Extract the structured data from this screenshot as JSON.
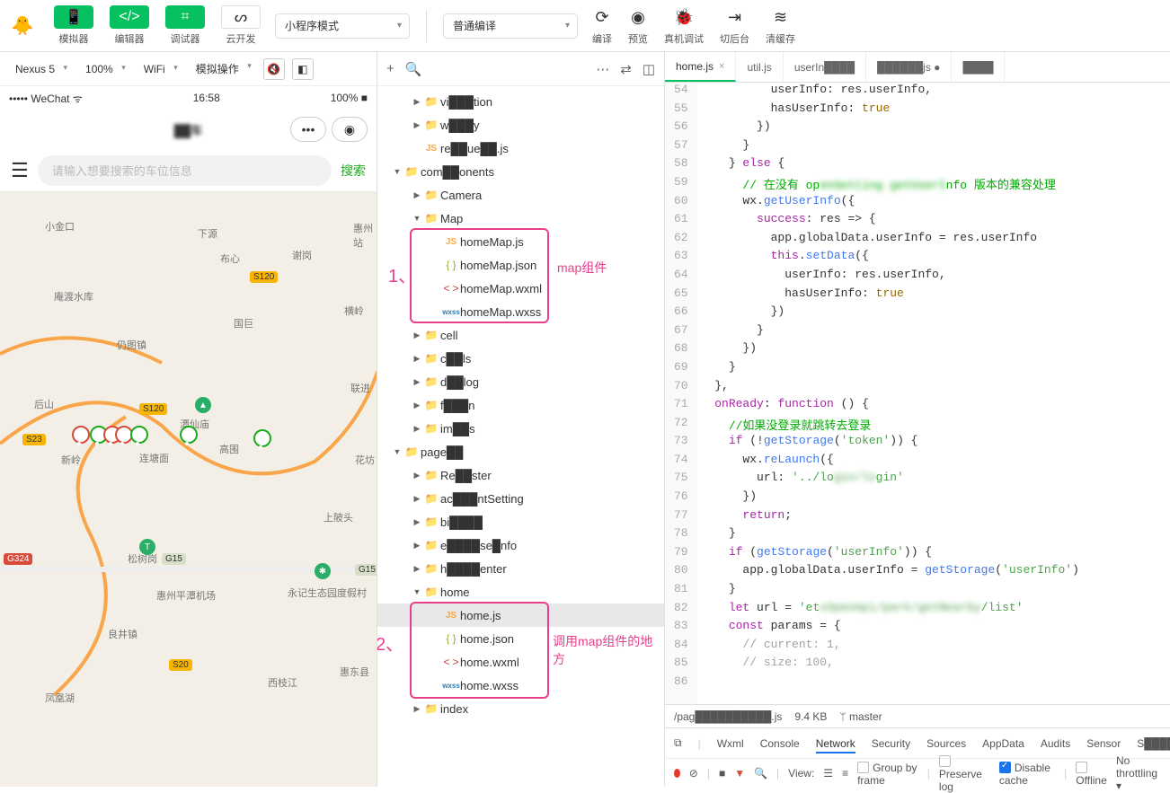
{
  "toolbar": {
    "simulator": "模拟器",
    "editor": "编辑器",
    "debugger": "调试器",
    "cloud": "云开发",
    "mode_select": "小程序模式",
    "compile_select": "普通编译",
    "compile": "编译",
    "preview": "预览",
    "remote_debug": "真机调试",
    "background": "切后台",
    "clear_cache": "清缓存"
  },
  "sim_bar": {
    "device": "Nexus 5",
    "zoom": "100%",
    "network": "WiFi",
    "operation": "模拟操作"
  },
  "phone": {
    "carrier": "••••• WeChat",
    "wifi_icon": "ᯤ",
    "time": "16:58",
    "battery_pct": "100%",
    "battery_icon": "▮▮▮",
    "title": "██车",
    "search_placeholder": "请输入想要搜索的车位信息",
    "search_btn": "搜索"
  },
  "map_labels": {
    "l1": "小金口",
    "l2": "下源",
    "l3": "谢岗",
    "l4": "惠州站",
    "l5": "仍图镇",
    "l6": "布心",
    "l7": "国巨",
    "l8": "横岭",
    "l9": "后山",
    "l10": "新岭",
    "l11": "潭仙庙",
    "l12": "连塘面",
    "l13": "高围",
    "l14": "花坊",
    "l15": "上陂头",
    "l16": "松树岗",
    "l17": "惠州平潭机场",
    "l18": "永记生态园度假村",
    "l19": "良井镇",
    "l20": "凤凰湖",
    "l21": "西枝江",
    "l22": "庵渡水库",
    "l23": "惠东县",
    "l24": "联进"
  },
  "badges": {
    "s120a": "S120",
    "s120b": "S120",
    "s23": "S23",
    "g324": "G324",
    "s20": "S20",
    "g15a": "G15",
    "g15b": "G15"
  },
  "tree": {
    "items": [
      {
        "d": 1,
        "t": "f",
        "ic": "fld",
        "n": "vi███tion"
      },
      {
        "d": 1,
        "t": "f",
        "ic": "fld",
        "n": "w███y"
      },
      {
        "d": 1,
        "t": "l",
        "ic": "js",
        "n": "re██ue██.js"
      },
      {
        "d": 0,
        "t": "o",
        "ic": "fld",
        "n": "com██onents"
      },
      {
        "d": 1,
        "t": "f",
        "ic": "fld",
        "n": "Camera"
      },
      {
        "d": 1,
        "t": "o",
        "ic": "fld",
        "n": "Map"
      },
      {
        "d": 2,
        "t": "l",
        "ic": "js",
        "n": "homeMap.js"
      },
      {
        "d": 2,
        "t": "l",
        "ic": "json",
        "n": "homeMap.json"
      },
      {
        "d": 2,
        "t": "l",
        "ic": "wxml",
        "n": "homeMap.wxml"
      },
      {
        "d": 2,
        "t": "l",
        "ic": "wxss",
        "n": "homeMap.wxss"
      },
      {
        "d": 1,
        "t": "f",
        "ic": "fld",
        "n": "cell"
      },
      {
        "d": 1,
        "t": "f",
        "ic": "fld",
        "n": "c██ls"
      },
      {
        "d": 1,
        "t": "f",
        "ic": "fld",
        "n": "d██log"
      },
      {
        "d": 1,
        "t": "f",
        "ic": "fld",
        "n": "f███n"
      },
      {
        "d": 1,
        "t": "f",
        "ic": "fld",
        "n": "im██s"
      },
      {
        "d": 0,
        "t": "o",
        "ic": "fld",
        "n": "page██"
      },
      {
        "d": 1,
        "t": "f",
        "ic": "fld",
        "n": "Re██ster"
      },
      {
        "d": 1,
        "t": "f",
        "ic": "fld",
        "n": "ac███ntSetting"
      },
      {
        "d": 1,
        "t": "f",
        "ic": "fld",
        "n": "bi████"
      },
      {
        "d": 1,
        "t": "f",
        "ic": "fld",
        "n": "e████se█nfo"
      },
      {
        "d": 1,
        "t": "f",
        "ic": "fld",
        "n": "h████enter"
      },
      {
        "d": 1,
        "t": "o",
        "ic": "fld",
        "n": "home"
      },
      {
        "d": 2,
        "t": "l",
        "ic": "js",
        "n": "home.js",
        "sel": true
      },
      {
        "d": 2,
        "t": "l",
        "ic": "json",
        "n": "home.json"
      },
      {
        "d": 2,
        "t": "l",
        "ic": "wxml",
        "n": "home.wxml"
      },
      {
        "d": 2,
        "t": "l",
        "ic": "wxss",
        "n": "home.wxss"
      },
      {
        "d": 1,
        "t": "f",
        "ic": "fld",
        "n": "index"
      }
    ]
  },
  "annotations": {
    "n1": "1、",
    "t1": "map组件",
    "n2": "2、",
    "t2": "调用map组件的地方"
  },
  "editor_tabs": [
    {
      "label": "home.js",
      "active": true,
      "close": true
    },
    {
      "label": "util.js"
    },
    {
      "label": "userIn████"
    },
    {
      "label": "██████js ●"
    },
    {
      "label": "████"
    }
  ],
  "code": {
    "start": 54,
    "lines": [
      "          userInfo: res.userInfo,",
      "          hasUserInfo: <b>true</b>",
      "        })",
      "      }",
      "    } <k>else</k> {",
      "      <c2>// 在没有 op<span style='filter:blur(3px)'>enSetting getUserI</span>nfo 版本的兼容处理</c2>",
      "      wx.<f>getUserInfo</f>({",
      "        <p>success</p>: res => {",
      "          app.globalData.userInfo = res.userInfo",
      "          <k>this</k>.<f>setData</f>({",
      "            userInfo: res.userInfo,",
      "            hasUserInfo: <b>true</b>",
      "          })",
      "        }",
      "      })",
      "    }",
      "  },",
      "  <p>onReady</p>: <k>function</k> () {",
      "    <c2>//如果没登录就跳转去登录</c2>",
      "    <k>if</k> (!<f>getStorage</f>(<s>'token'</s>)) {",
      "      wx.<f>reLaunch</f>({",
      "        url: <s>'../lo<span style=\"filter:blur(3px)\">gin/lo</span>gin'</s>",
      "      })",
      "      <k>return</k>;",
      "    }",
      "    <k>if</k> (<f>getStorage</f>(<s>'userInfo'</s>)) {",
      "      app.globalData.userInfo = <f>getStorage</f>(<s>'userInfo'</s>)",
      "    }",
      "    <k>let</k> url = <s>'et<span style=\"filter:blur(3px)\">cOpenApi/park/getNearby</span>/list'</s>",
      "    <k>const</k> params = {",
      "      <c>// current: 1,</c>",
      "      <c>// size: 100,</c>",
      ""
    ]
  },
  "status": {
    "path": "/pag██████████.js",
    "size": "9.4 KB",
    "branch": "master"
  },
  "devtools": {
    "tabs": [
      "Wxml",
      "Console",
      "Network",
      "Security",
      "Sources",
      "AppData",
      "Audits",
      "Sensor",
      "S████",
      "████"
    ],
    "active": "Network",
    "view": "View:",
    "group": "Group by frame",
    "preserve": "Preserve log",
    "disable": "Disable cache",
    "offline": "Offline",
    "throttling": "No throttling"
  }
}
